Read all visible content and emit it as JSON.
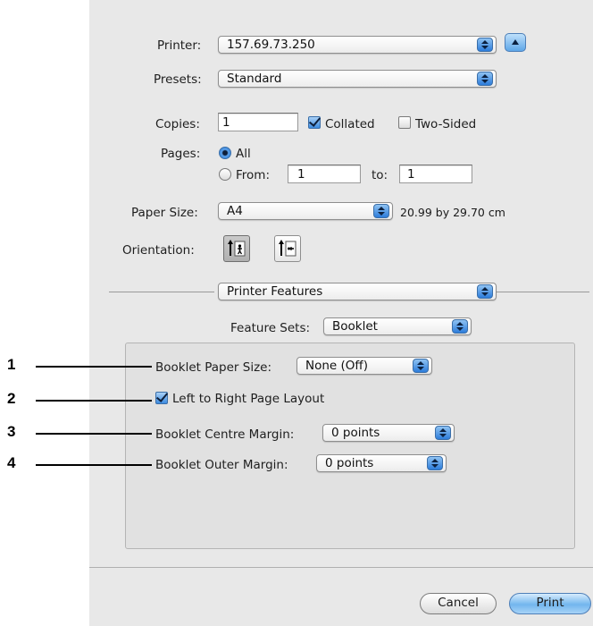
{
  "printer": {
    "label": "Printer:",
    "value": "157.69.73.250"
  },
  "presets": {
    "label": "Presets:",
    "value": "Standard"
  },
  "copies": {
    "label": "Copies:",
    "value": "1",
    "collated_label": "Collated",
    "collated_checked": true,
    "two_sided_label": "Two-Sided",
    "two_sided_checked": false
  },
  "pages": {
    "label": "Pages:",
    "all_label": "All",
    "from_label": "From:",
    "from_value": "1",
    "to_label": "to:",
    "to_value": "1",
    "selected": "All"
  },
  "paper_size": {
    "label": "Paper Size:",
    "value": "A4",
    "dimensions": "20.99 by 29.70 cm"
  },
  "orientation": {
    "label": "Orientation:",
    "selected": "portrait"
  },
  "section_popup": {
    "value": "Printer Features"
  },
  "feature_sets": {
    "label": "Feature Sets:",
    "value": "Booklet"
  },
  "booklet": {
    "paper_size_label": "Booklet Paper Size:",
    "paper_size_value": "None (Off)",
    "left_to_right_label": "Left to Right Page Layout",
    "left_to_right_checked": true,
    "centre_margin_label": "Booklet Centre Margin:",
    "centre_margin_value": "0 points",
    "outer_margin_label": "Booklet Outer Margin:",
    "outer_margin_value": "0 points"
  },
  "callouts": [
    "1",
    "2",
    "3",
    "4"
  ],
  "buttons": {
    "cancel": "Cancel",
    "print": "Print"
  },
  "colors": {
    "accent": "#3d8be0",
    "panel": "#e8e8e8"
  },
  "icons": [
    "stepper-icon",
    "expand-icon",
    "portrait-icon",
    "landscape-icon",
    "checkmark-icon",
    "radio-icon"
  ]
}
